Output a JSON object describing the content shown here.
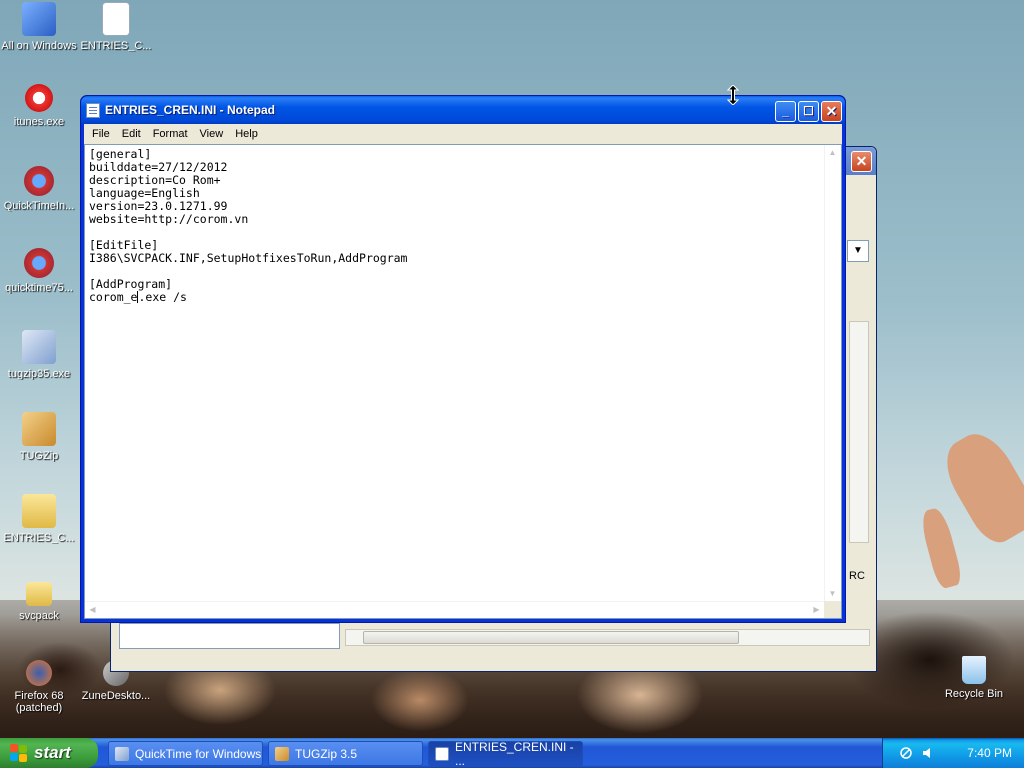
{
  "desktop": {
    "icons": [
      {
        "label": "All on Windows"
      },
      {
        "label": "ENTRIES_C..."
      },
      {
        "label": "itunes.exe"
      },
      {
        "label": "QuickTimeIn..."
      },
      {
        "label": "quicktime75..."
      },
      {
        "label": "tugzip35.exe"
      },
      {
        "label": "TUGZip"
      },
      {
        "label": "ENTRIES_C..."
      },
      {
        "label": "svcpack"
      },
      {
        "label": "Firefox 68 (patched)"
      },
      {
        "label": "ZuneDeskto..."
      },
      {
        "label": "Recycle Bin"
      }
    ]
  },
  "notepad": {
    "title": "ENTRIES_CREN.INI - Notepad",
    "menu": [
      "File",
      "Edit",
      "Format",
      "View",
      "Help"
    ],
    "lines": [
      "[general]",
      "builddate=27/12/2012",
      "description=Co Rom+",
      "language=English",
      "version=23.0.1271.99",
      "website=http://corom.vn",
      "",
      "[EditFile]",
      "I386\\SVCPACK.INF,SetupHotfixesToRun,AddProgram",
      "",
      "[AddProgram]"
    ],
    "last_line_before_caret": "corom_e",
    "last_line_after_caret": ".exe /s"
  },
  "background_window": {
    "fragment_label": "RC"
  },
  "taskbar": {
    "start_label": "start",
    "buttons": [
      {
        "label": "QuickTime for Windows",
        "active": false
      },
      {
        "label": "TUGZip 3.5",
        "active": false
      },
      {
        "label": "ENTRIES_CREN.INI - ...",
        "active": true
      }
    ],
    "clock": "7:40 PM"
  }
}
